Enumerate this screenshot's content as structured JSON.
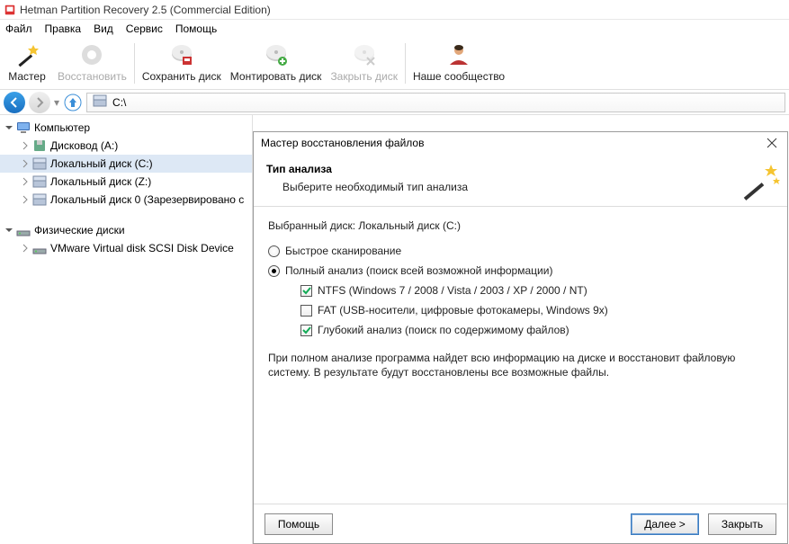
{
  "window": {
    "title": "Hetman Partition Recovery 2.5 (Commercial Edition)"
  },
  "menu": {
    "file": "Файл",
    "edit": "Правка",
    "view": "Вид",
    "service": "Сервис",
    "help": "Помощь"
  },
  "toolbar": {
    "wizard": "Мастер",
    "recover": "Восстановить",
    "save_disk": "Сохранить диск",
    "mount_disk": "Монтировать диск",
    "close_disk": "Закрыть диск",
    "community": "Наше сообщество"
  },
  "address": {
    "path": "C:\\"
  },
  "tree": {
    "computer": "Компьютер",
    "children": [
      {
        "label": "Дисковод (A:)"
      },
      {
        "label": "Локальный диск (C:)",
        "selected": true
      },
      {
        "label": "Локальный диск (Z:)"
      },
      {
        "label": "Локальный диск 0 (Зарезервировано с"
      }
    ],
    "physical": "Физические диски",
    "phys_children": [
      {
        "label": "VMware Virtual disk SCSI Disk Device"
      }
    ]
  },
  "dialog": {
    "title": "Мастер восстановления файлов",
    "heading": "Тип анализа",
    "subheading": "Выберите необходимый тип анализа",
    "selected_disk_label": "Выбранный диск: Локальный диск (C:)",
    "option_fast": "Быстрое сканирование",
    "option_full": "Полный анализ (поиск всей возможной информации)",
    "chk_ntfs": "NTFS (Windows 7 / 2008 / Vista / 2003 / XP / 2000 / NT)",
    "chk_fat": "FAT (USB-носители, цифровые фотокамеры, Windows 9x)",
    "chk_deep": "Глубокий анализ (поиск по содержимому файлов)",
    "note": "При полном анализе программа найдет всю информацию на диске и восстановит файловую систему. В результате будут восстановлены все возможные файлы.",
    "btn_help": "Помощь",
    "btn_next": "Далее >",
    "btn_close": "Закрыть"
  }
}
